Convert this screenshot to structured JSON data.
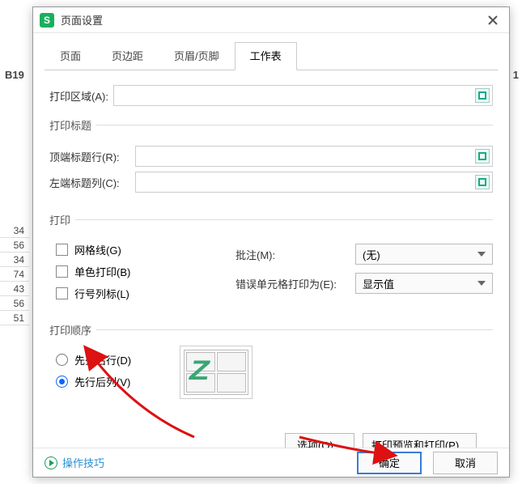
{
  "bg": {
    "colhdr_left": "B19",
    "right_hdr": "1",
    "rows": [
      "34",
      "56",
      "34",
      "74",
      "43",
      "56",
      "51"
    ]
  },
  "titlebar": {
    "app_icon": "S",
    "title": "页面设置"
  },
  "tabs": {
    "t0": "页面",
    "t1": "页边距",
    "t2": "页眉/页脚",
    "t3": "工作表"
  },
  "print_area": {
    "label": "打印区域(A):"
  },
  "print_titles": {
    "legend": "打印标题",
    "top_label": "顶端标题行(R):",
    "left_label": "左端标题列(C):"
  },
  "print": {
    "legend": "打印",
    "grid": "网格线(G)",
    "mono": "单色打印(B)",
    "rowcol": "行号列标(L)",
    "comments_label": "批注(M):",
    "comments_value": "(无)",
    "errors_label": "错误单元格打印为(E):",
    "errors_value": "显示值"
  },
  "order": {
    "legend": "打印顺序",
    "opt1": "先列后行(D)",
    "opt2": "先行后列(V)"
  },
  "buttons": {
    "options": "选项(O)...",
    "preview": "打印预览和打印(P)...",
    "ok": "确定",
    "cancel": "取消"
  },
  "footer": {
    "tips": "操作技巧"
  }
}
